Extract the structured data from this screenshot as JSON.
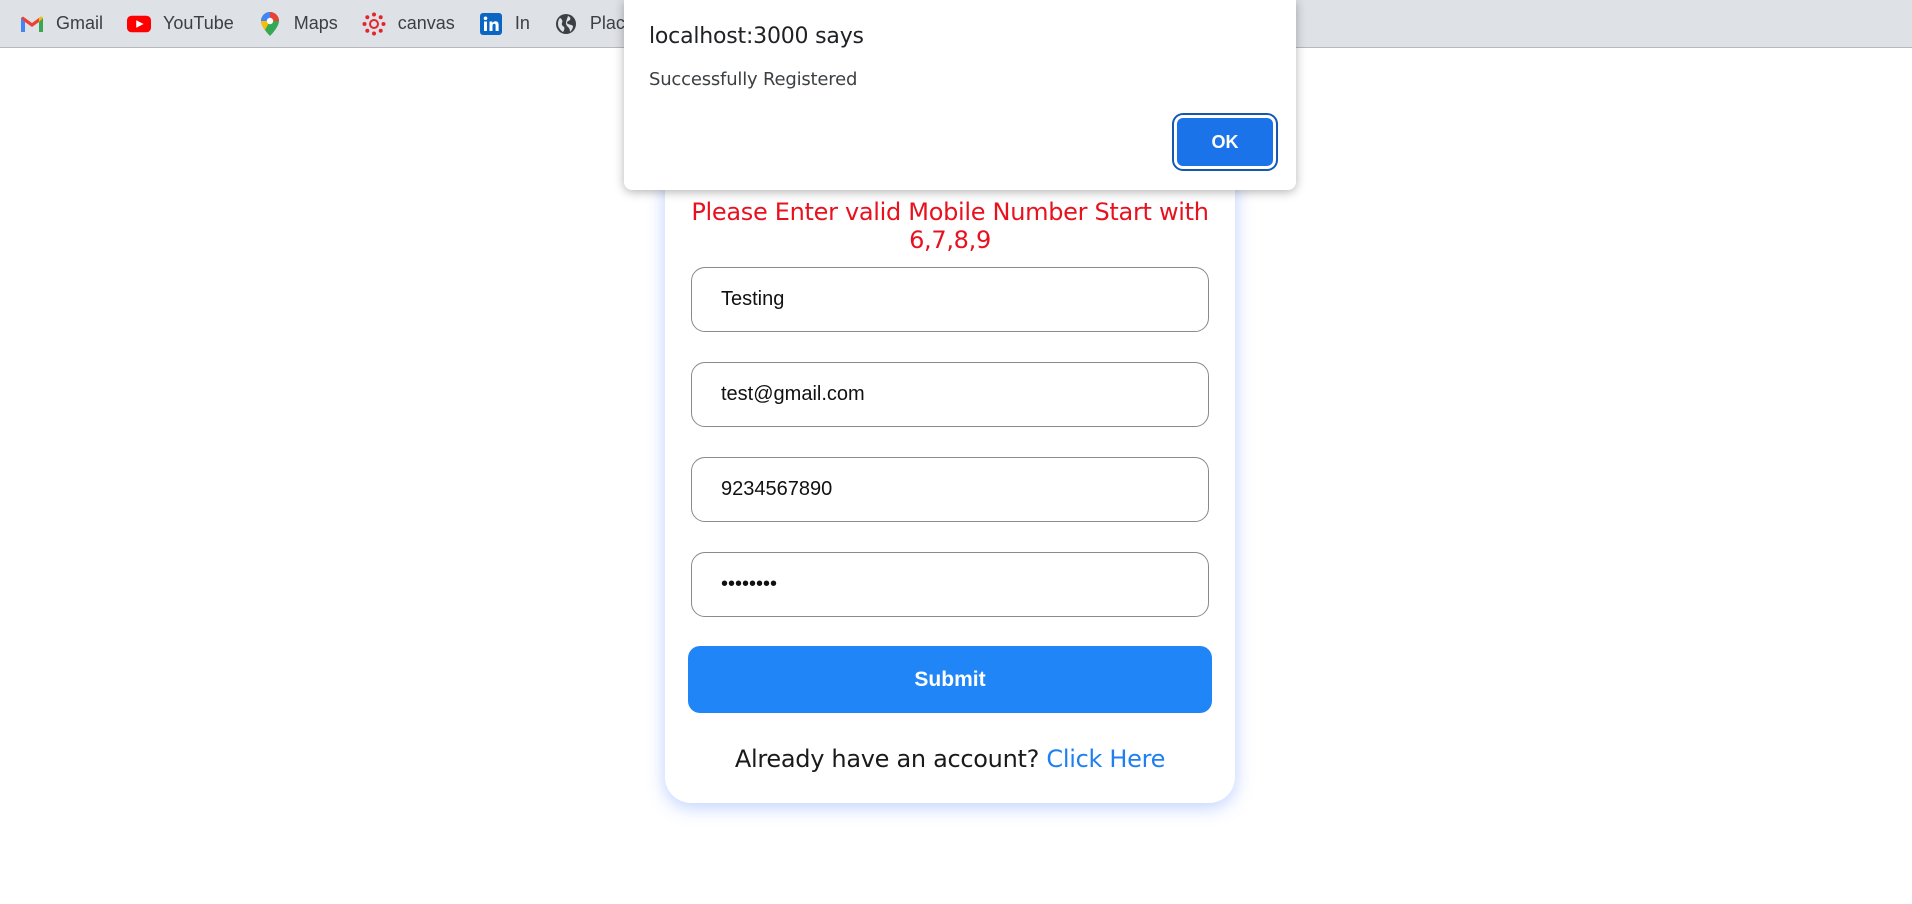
{
  "bookmarks": [
    {
      "label": "Gmail",
      "icon": "gmail-icon"
    },
    {
      "label": "YouTube",
      "icon": "youtube-icon"
    },
    {
      "label": "Maps",
      "icon": "maps-icon"
    },
    {
      "label": "canvas",
      "icon": "canvas-icon"
    },
    {
      "label": "In",
      "icon": "linkedin-icon"
    },
    {
      "label": "Places",
      "icon": "globe-icon"
    }
  ],
  "dialog": {
    "title": "localhost:3000 says",
    "message": "Successfully Registered",
    "ok_label": "OK"
  },
  "form": {
    "error_message": "Please Enter valid Mobile Number Start with 6,7,8,9",
    "name_value": "Testing",
    "email_value": "test@gmail.com",
    "mobile_value": "9234567890",
    "password_value": "password",
    "submit_label": "Submit",
    "login_prompt": "Already have an account?",
    "login_link": "Click Here"
  },
  "colors": {
    "error": "#e8121f",
    "primary": "#2085f7",
    "link": "#1f7ff0",
    "dialog_button": "#1a73e8"
  }
}
